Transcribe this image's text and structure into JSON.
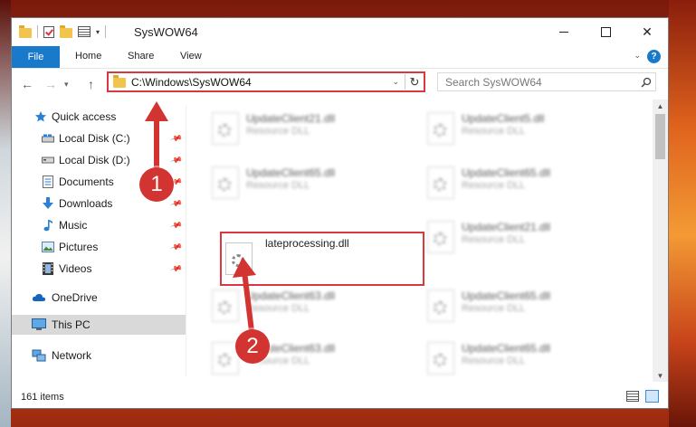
{
  "window": {
    "title": "SysWOW64",
    "controls": {
      "minimize": "minimize-icon",
      "maximize": "maximize-icon",
      "close": "✕"
    }
  },
  "ribbon": {
    "file": "File",
    "tabs": [
      "Home",
      "Share",
      "View"
    ],
    "help": "?"
  },
  "address": {
    "path": "C:\\Windows\\SysWOW64",
    "refresh": "↻"
  },
  "search": {
    "placeholder": "Search SysWOW64"
  },
  "sidebar": {
    "items": [
      {
        "label": "Quick access",
        "icon": "star-icon"
      },
      {
        "label": "Local Disk (C:)",
        "icon": "drive-icon"
      },
      {
        "label": "Local Disk (D:)",
        "icon": "drive-icon"
      },
      {
        "label": "Documents",
        "icon": "documents-icon"
      },
      {
        "label": "Downloads",
        "icon": "download-icon"
      },
      {
        "label": "Music",
        "icon": "music-icon"
      },
      {
        "label": "Pictures",
        "icon": "pictures-icon"
      },
      {
        "label": "Videos",
        "icon": "videos-icon"
      },
      {
        "label": "OneDrive",
        "icon": "cloud-icon"
      },
      {
        "label": "This PC",
        "icon": "computer-icon"
      },
      {
        "label": "Network",
        "icon": "network-icon"
      }
    ]
  },
  "files": [
    {
      "name": "UpdateClient21.dll",
      "type": "Resource DLL"
    },
    {
      "name": "UpdateClient5.dll",
      "type": "Resource DLL"
    },
    {
      "name": "UpdateClient65.dll",
      "type": "Resource DLL"
    },
    {
      "name": "UpdateClient65.dll",
      "type": "Resource DLL"
    },
    {
      "name": "lateprocessing.dll",
      "type": ""
    },
    {
      "name": "UpdateClient21.dll",
      "type": "Resource DLL"
    },
    {
      "name": "UpdateClient63.dll",
      "type": "Resource DLL"
    },
    {
      "name": "UpdateClient65.dll",
      "type": "Resource DLL"
    },
    {
      "name": "UpdateClient63.dll",
      "type": "Resource DLL"
    },
    {
      "name": "UpdateClient65.dll",
      "type": "Resource DLL"
    }
  ],
  "status": {
    "items": "161 items"
  },
  "annotations": {
    "step1": "1",
    "step2": "2"
  },
  "colors": {
    "accent": "#1979ca",
    "highlight": "#d9393e",
    "selected": "#cce8ff"
  }
}
